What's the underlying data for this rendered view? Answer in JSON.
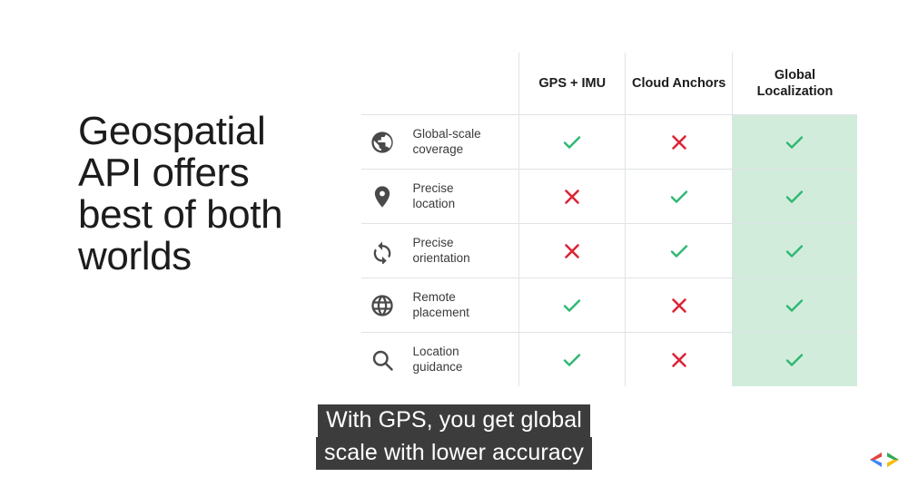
{
  "headline": {
    "lines": [
      "Geospatial",
      "API offers",
      "best of both",
      "worlds"
    ],
    "full_text": "Geospatial API offers best of both worlds"
  },
  "table": {
    "column_headers": [
      {
        "label": "GPS + IMU",
        "highlighted": false
      },
      {
        "label": "Cloud Anchors",
        "highlighted": false
      },
      {
        "label": "Global\nLocalization",
        "line1": "Global",
        "line2": "Localization",
        "highlighted": true
      }
    ],
    "rows": [
      {
        "icon": "public-globe-icon",
        "label_line1": "Global-scale",
        "label_line2": "coverage",
        "values": [
          "check",
          "cross",
          "check"
        ]
      },
      {
        "icon": "location-pin-icon",
        "label_line1": "Precise",
        "label_line2": "location",
        "values": [
          "cross",
          "check",
          "check"
        ]
      },
      {
        "icon": "sync-rotate-icon",
        "label_line1": "Precise",
        "label_line2": "orientation",
        "values": [
          "cross",
          "check",
          "check"
        ]
      },
      {
        "icon": "globe-grid-icon",
        "label_line1": "Remote",
        "label_line2": "placement",
        "values": [
          "check",
          "cross",
          "check"
        ]
      },
      {
        "icon": "magnifier-search-icon",
        "label_line1": "Location",
        "label_line2": "guidance",
        "values": [
          "check",
          "cross",
          "check"
        ]
      }
    ]
  },
  "caption": {
    "line1": "With GPS, you get global",
    "line2": "scale with lower accuracy",
    "full_text": "With GPS, you get global scale with lower accuracy"
  },
  "logo": {
    "name": "google-developers-code-icon",
    "glyph": "<>"
  },
  "colors": {
    "check_green": "#2eb873",
    "cross_red": "#dd2536",
    "highlight_green": "#d2ecdb",
    "grid_line": "#dfe3e6",
    "text_dark": "#1c1c1c",
    "label_gray": "#3a3a3a",
    "icon_gray": "#4a4a4a",
    "caption_bg": "#3c3c3c",
    "caption_fg": "#ffffff",
    "logo_blue": "#4285f4",
    "logo_red": "#ea4335",
    "logo_yellow": "#fbbc04",
    "logo_green": "#34a853",
    "background": "#ffffff"
  }
}
